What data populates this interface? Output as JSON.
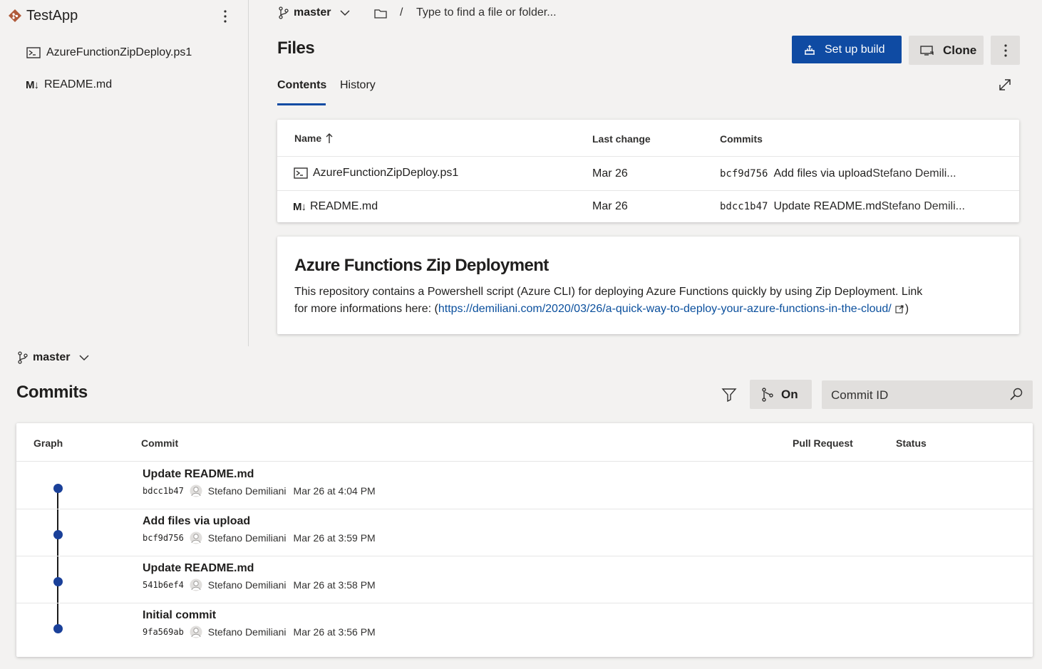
{
  "colors": {
    "accent": "#0f4ba3",
    "link": "#0a4f9d",
    "graph_node": "#1a4099",
    "app_logo": "#b05a3a"
  },
  "sidebar": {
    "app_name": "TestApp",
    "items": [
      {
        "label": "AzureFunctionZipDeploy.ps1",
        "icon": "powershell-file-icon"
      },
      {
        "label": "README.md",
        "icon": "markdown-file-icon"
      }
    ]
  },
  "topbar": {
    "branch": "master",
    "path_separator": "/",
    "path_placeholder": "Type to find a file or folder..."
  },
  "files": {
    "title": "Files",
    "setup_build_label": "Set up build",
    "clone_label": "Clone",
    "tabs": [
      "Contents",
      "History"
    ],
    "active_tab": "Contents",
    "table": {
      "headers": {
        "name": "Name",
        "last_change": "Last change",
        "commits": "Commits"
      },
      "rows": [
        {
          "name": "AzureFunctionZipDeploy.ps1",
          "icon": "powershell-file-icon",
          "last_change": "Mar 26",
          "commit_id": "bcf9d756",
          "commit_message": "Add files via upload",
          "commit_author": "Stefano Demili..."
        },
        {
          "name": "README.md",
          "icon": "markdown-file-icon",
          "last_change": "Mar 26",
          "commit_id": "bdcc1b47",
          "commit_message": "Update README.md",
          "commit_author": "Stefano Demili..."
        }
      ]
    }
  },
  "readme": {
    "title": "Azure Functions Zip Deployment",
    "text_line1": "This repository contains a Powershell script (Azure CLI) for deploying Azure Functions quickly by using Zip Deployment. Link",
    "text_line2_prefix": "for more informations here: (",
    "link_text": "https://demiliani.com/2020/03/26/a-quick-way-to-deploy-your-azure-functions-in-the-cloud/",
    "text_line2_suffix": ")"
  },
  "commits_section": {
    "branch": "master",
    "title": "Commits",
    "graph_toggle_label": "On",
    "search_placeholder": "Commit ID",
    "headers": {
      "graph": "Graph",
      "commit": "Commit",
      "pull_request": "Pull Request",
      "status": "Status"
    },
    "rows": [
      {
        "title": "Update README.md",
        "id": "bdcc1b47",
        "author": "Stefano Demiliani",
        "date": "Mar 26 at 4:04 PM"
      },
      {
        "title": "Add files via upload",
        "id": "bcf9d756",
        "author": "Stefano Demiliani",
        "date": "Mar 26 at 3:59 PM"
      },
      {
        "title": "Update README.md",
        "id": "541b6ef4",
        "author": "Stefano Demiliani",
        "date": "Mar 26 at 3:58 PM"
      },
      {
        "title": "Initial commit",
        "id": "9fa569ab",
        "author": "Stefano Demiliani",
        "date": "Mar 26 at 3:56 PM"
      }
    ]
  }
}
